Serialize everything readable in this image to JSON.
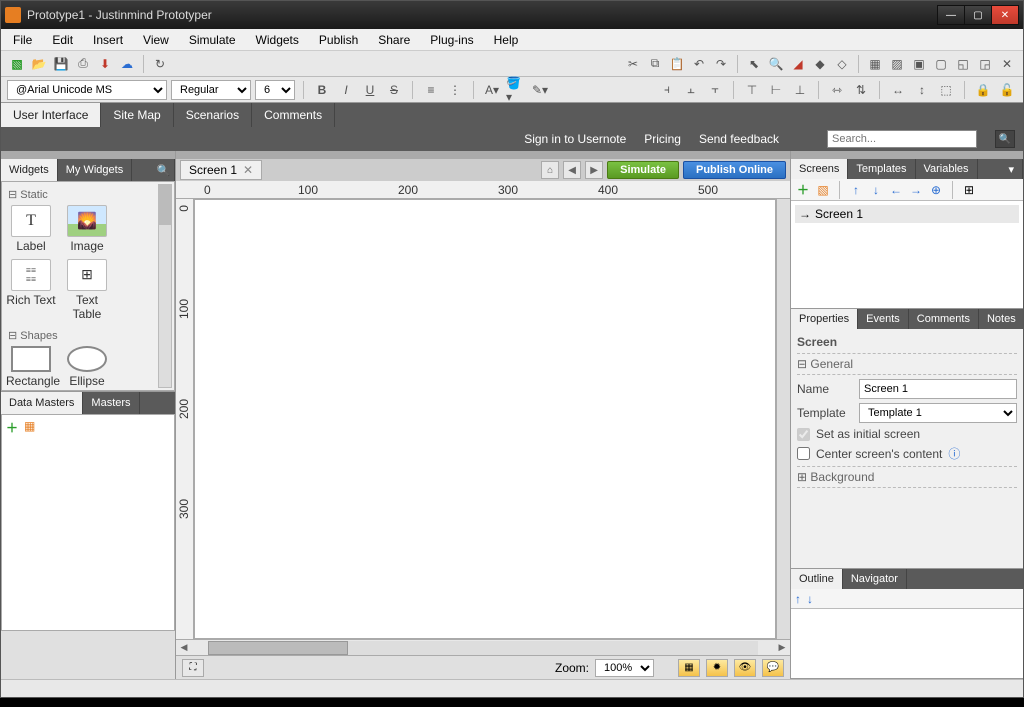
{
  "title": "Prototype1 - Justinmind Prototyper",
  "menu": [
    "File",
    "Edit",
    "Insert",
    "View",
    "Simulate",
    "Widgets",
    "Publish",
    "Share",
    "Plug-ins",
    "Help"
  ],
  "font": {
    "family": "@Arial Unicode MS",
    "style": "Regular",
    "size": "6"
  },
  "main_tabs": [
    "User Interface",
    "Site Map",
    "Scenarios",
    "Comments"
  ],
  "sub_links": {
    "signin": "Sign in to Usernote",
    "pricing": "Pricing",
    "feedback": "Send feedback"
  },
  "search_placeholder": "Search...",
  "left": {
    "tabs": [
      "Widgets",
      "My Widgets"
    ],
    "static_hdr": "⊟ Static",
    "items": {
      "label": "Label",
      "image": "Image",
      "richtext": "Rich Text",
      "texttable": "Text Table"
    },
    "shapes_hdr": "⊟ Shapes",
    "shapes": {
      "rect": "Rectangle",
      "ellipse": "Ellipse"
    },
    "dm_tabs": [
      "Data Masters",
      "Masters"
    ]
  },
  "editor": {
    "tab": "Screen 1",
    "simulate": "Simulate",
    "publish": "Publish Online",
    "ruler_ticks": [
      "0",
      "100",
      "200",
      "300",
      "400",
      "500"
    ],
    "zoom_label": "Zoom:",
    "zoom_value": "100%"
  },
  "right": {
    "screens_tabs": [
      "Screens",
      "Templates",
      "Variables"
    ],
    "screen_item": "Screen 1",
    "props_tabs": [
      "Properties",
      "Events",
      "Comments",
      "Notes"
    ],
    "prop_header": "Screen",
    "general": "⊟  General",
    "name_label": "Name",
    "name_value": "Screen 1",
    "template_label": "Template",
    "template_value": "Template 1",
    "initial": "Set as initial screen",
    "center": "Center screen's content",
    "background": "⊞  Background",
    "outline_tabs": [
      "Outline",
      "Navigator"
    ]
  }
}
